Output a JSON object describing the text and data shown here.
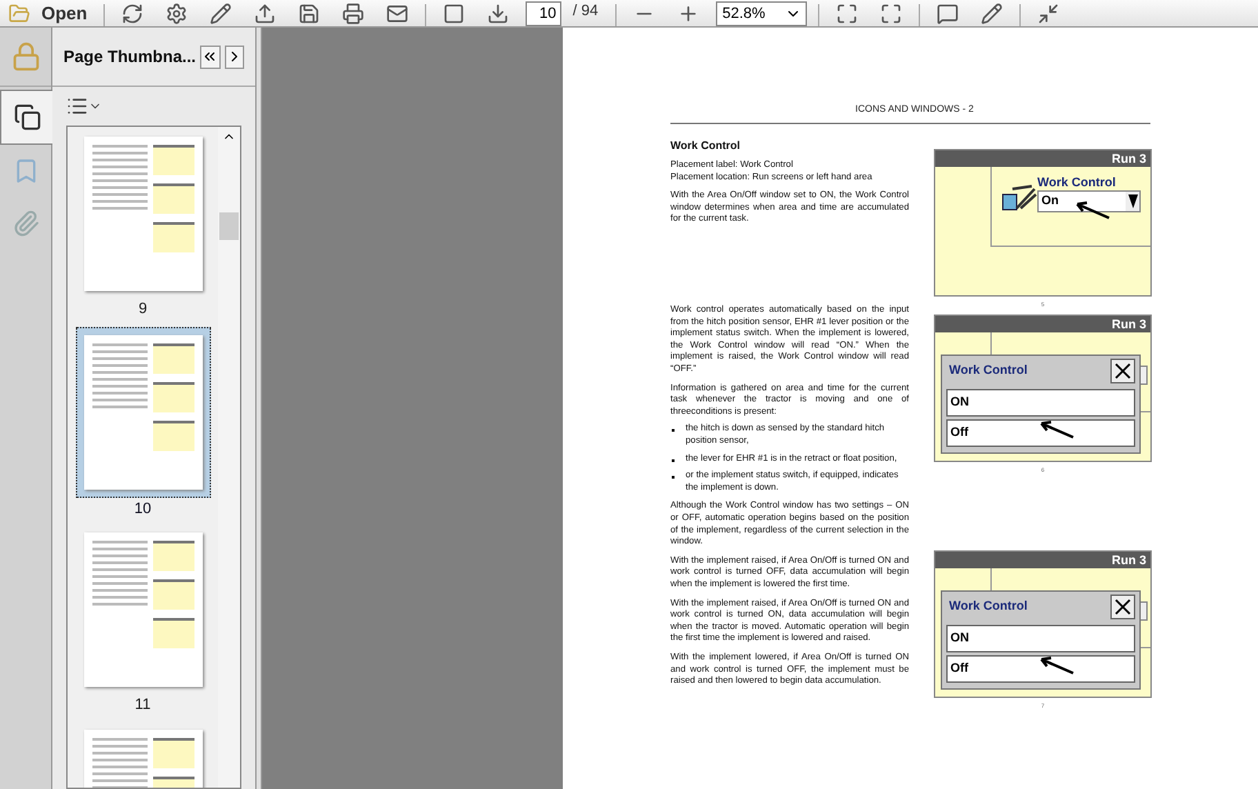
{
  "toolbar": {
    "open_label": "Open",
    "page_number": "10",
    "page_total": "/ 94",
    "zoom": "52.8%"
  },
  "side_tabs": [
    {
      "kind": "pages",
      "selected": true
    },
    {
      "kind": "bookmarks",
      "selected": false
    },
    {
      "kind": "attachments",
      "selected": false
    }
  ],
  "thumbnails_panel": {
    "title": "Page Thumbna...",
    "pages": [
      {
        "label": "9",
        "selected": false
      },
      {
        "label": "10",
        "selected": true
      },
      {
        "label": "11",
        "selected": false
      },
      {
        "selected": false
      }
    ]
  },
  "document": {
    "header": "ICONS AND WINDOWS - 2",
    "blocks": [
      {
        "kind": "heading",
        "text": "Work Control"
      },
      {
        "kind": "line",
        "text": "Placement label: Work Control"
      },
      {
        "kind": "line",
        "text": "Placement location: Run screens or left hand area"
      },
      {
        "kind": "para",
        "text": "With the Area On/Off window set to ON, the Work Control window determines when area and time are accumulated for the current task."
      },
      {
        "kind": "spacer"
      },
      {
        "kind": "para",
        "text": "Work control operates automatically based on the input from the hitch position sensor, EHR #1 lever position or the implement status switch. When the implement is lowered, the Work Control window will read “ON.” When the implement is raised, the Work Control window will read “OFF.”"
      },
      {
        "kind": "para",
        "text": "Information is gathered on area and time for the current task whenever the tractor is moving and one of threeconditions is present:"
      },
      {
        "kind": "bullet",
        "text": "the hitch is down as sensed by the standard hitch position sensor,"
      },
      {
        "kind": "bullet",
        "text": "the lever for EHR #1 is in the retract or float position,"
      },
      {
        "kind": "bullet",
        "text": "or the implement status switch, if equipped, indicates the implement is down."
      },
      {
        "kind": "para",
        "text": "Although the Work Control window has two settings – ON or OFF, automatic operation begins based on the position of the implement, regardless of the current selection in the window."
      },
      {
        "kind": "para",
        "text": "With the implement raised, if Area On/Off is turned ON and work control is turned OFF, data accumulation will begin when the implement is lowered the first time."
      },
      {
        "kind": "para",
        "text": "With the implement raised, if Area On/Off is turned ON and work control is turned ON, data accumulation will begin when the tractor is moved.  Automatic operation will begin the first time the implement is lowered and raised."
      },
      {
        "kind": "para",
        "text": "With the implement lowered, if Area On/Off is turned ON and work control is turned OFF, the implement must be raised and then lowered to begin data accumulation."
      }
    ],
    "figures": [
      {
        "kind": "dropdown",
        "header": "Run 3",
        "title": "Work Control",
        "value": "On",
        "caption": "5"
      },
      {
        "kind": "dialog",
        "header": "Run 3",
        "title": "Work Control",
        "options": [
          "ON",
          "Off"
        ],
        "caption": "6"
      },
      {
        "kind": "dialog",
        "header": "Run 3",
        "title": "Work Control",
        "options": [
          "ON",
          "Off"
        ],
        "caption": "7"
      }
    ]
  }
}
